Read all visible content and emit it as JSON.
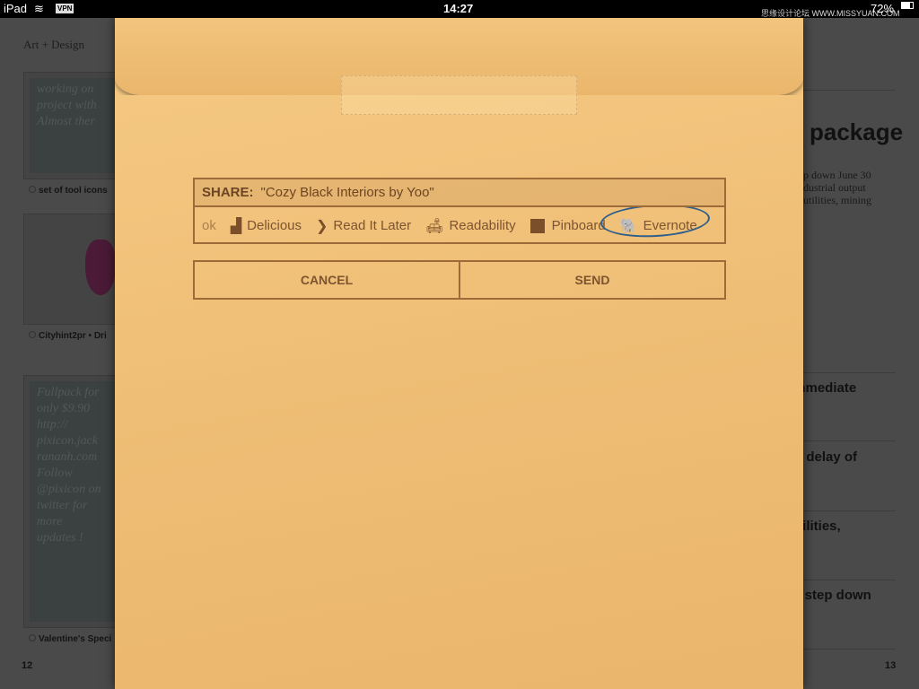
{
  "status": {
    "device": "iPad",
    "vpn": "VPN",
    "time": "14:27",
    "battery": "72%",
    "watermark": "思缘设计论坛 WWW.MISSYUAN.COM"
  },
  "left_page": {
    "section": "Art + Design",
    "cards": [
      {
        "text": "working on\nproject with\nAlmost ther",
        "caption": "set of tool icons"
      },
      {
        "text": "",
        "caption": "Cityhint2pr • Dri"
      },
      {
        "text": "Fullpack for\nonly $9.90\nhttp://\npixicon.jack\nrananh.com\nFollow\n@pixicon on\ntwitter for\nmore\nupdates !",
        "caption": "Valentine's Speci"
      }
    ],
    "page_number": "12"
  },
  "right_page": {
    "headline": "package",
    "subtext": "p down June 30\ndustrial output\nutilities, mining",
    "items": [
      "immediate",
      "rs delay of",
      "utilities,",
      "ill step down"
    ],
    "page_number": "13"
  },
  "share": {
    "label": "SHARE:",
    "title": "\"Cozy Black Interiors by Yoo\"",
    "services": [
      {
        "name": "ok",
        "icon": "facebook-icon"
      },
      {
        "name": "Delicious",
        "icon": "delicious-icon"
      },
      {
        "name": "Read It Later",
        "icon": "read-it-later-icon"
      },
      {
        "name": "Readability",
        "icon": "readability-icon"
      },
      {
        "name": "Pinboard",
        "icon": "pinboard-icon"
      },
      {
        "name": "Evernote",
        "icon": "evernote-icon",
        "highlighted": true
      }
    ]
  },
  "actions": {
    "cancel": "CANCEL",
    "send": "SEND"
  },
  "colors": {
    "envelope": "#efbe76",
    "border": "#9d6a3a",
    "text": "#7d5430",
    "highlight_ring": "#2f5f8a"
  }
}
